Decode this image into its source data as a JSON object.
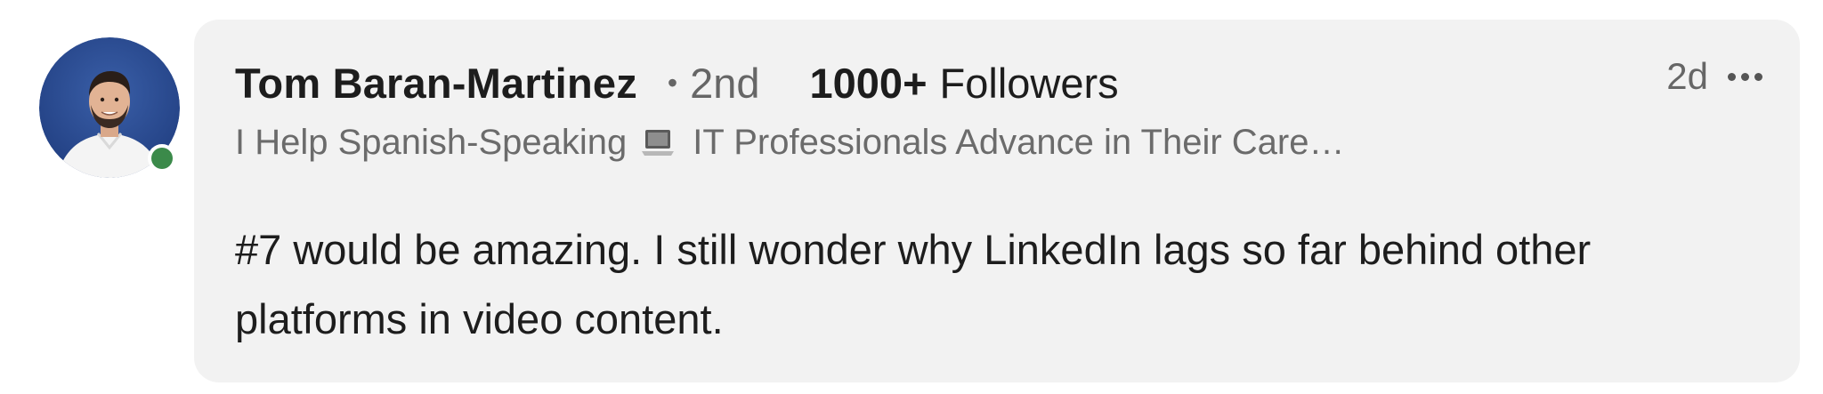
{
  "comment": {
    "author": {
      "name": "Tom Baran-Martinez",
      "degree_separator": "•",
      "degree": "2nd",
      "followers_count": "1000+",
      "followers_label": "Followers",
      "headline_part1": "I Help Spanish-Speaking",
      "headline_icon": "laptop-icon",
      "headline_part2": "IT Professionals Advance in Their Care…",
      "presence_color": "#3b8a4a"
    },
    "timestamp": "2d",
    "more_icon": "ellipsis-icon",
    "text": "#7 would be amazing. I still wonder why LinkedIn lags so far behind other platforms in video content."
  },
  "colors": {
    "bubble_bg": "#f2f2f2",
    "primary_text": "#1d1d1d",
    "secondary_text": "#666666",
    "presence_green": "#3b8a4a",
    "avatar_bg": "#27498f"
  }
}
